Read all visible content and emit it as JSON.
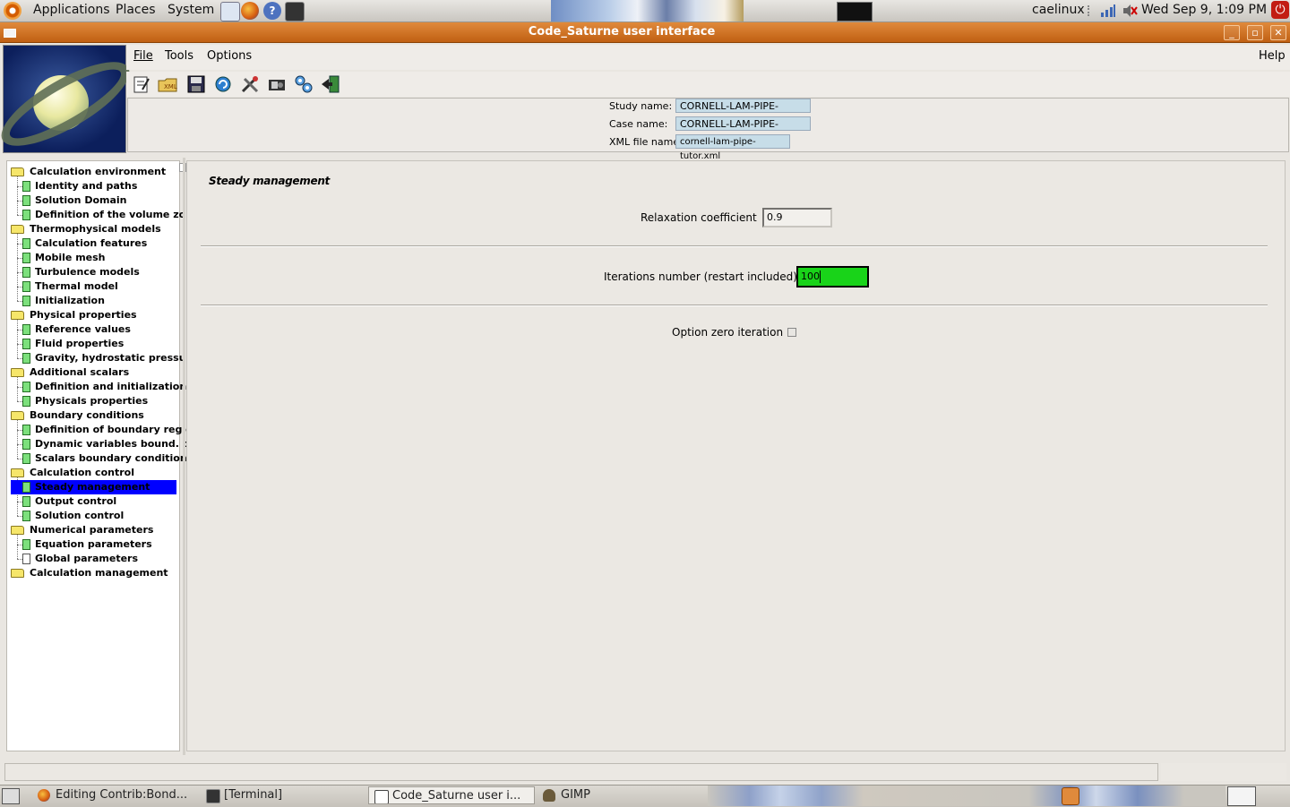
{
  "top_panel": {
    "menus": [
      "Applications",
      "Places",
      "System"
    ],
    "user": "caelinux",
    "clock": "Wed Sep  9,  1:09 PM"
  },
  "window": {
    "title": "Code_Saturne user interface"
  },
  "menubar": {
    "file": "File",
    "tools": "Tools",
    "options": "Options",
    "help": "Help"
  },
  "toolbar": {
    "icons": [
      "new-case-icon",
      "open-xml-icon",
      "save-icon",
      "preprocessor-icon",
      "tools-icon",
      "identity-icon",
      "run-icon",
      "quit-icon"
    ]
  },
  "identity": {
    "study_label": "Study name:",
    "study_value": "CORNELL-LAM-PIPE-TUTOR",
    "case_label": "Case name:",
    "case_value": "CORNELL-LAM-PIPE-TUTOR",
    "xml_label": "XML file name:",
    "xml_value": "cornell-lam-pipe-tutor.xml"
  },
  "tree": {
    "folders": [
      {
        "label": "Calculation environment",
        "items": [
          "Identity and paths",
          "Solution Domain",
          "Definition of the volume zones"
        ]
      },
      {
        "label": "Thermophysical models",
        "items": [
          "Calculation features",
          "Mobile mesh",
          "Turbulence models",
          "Thermal model",
          "Initialization"
        ]
      },
      {
        "label": "Physical properties",
        "items": [
          "Reference values",
          "Fluid properties",
          "Gravity, hydrostatic pressure"
        ]
      },
      {
        "label": "Additional scalars",
        "items": [
          "Definition and initialization",
          "Physicals properties"
        ]
      },
      {
        "label": "Boundary conditions",
        "items": [
          "Definition of boundary regions",
          "Dynamic variables bound. cond.",
          "Scalars boundary conditions"
        ]
      },
      {
        "label": "Calculation control",
        "items": [
          "Steady management",
          "Output control",
          "Solution control"
        ]
      },
      {
        "label": "Numerical parameters",
        "items": [
          "Equation parameters",
          "Global parameters"
        ]
      },
      {
        "label": "Calculation management",
        "items": []
      }
    ],
    "selected": "Steady management"
  },
  "main": {
    "heading": "Steady management",
    "relaxation_label": "Relaxation coefficient",
    "relaxation_value": "0.9",
    "iterations_label": "Iterations number (restart included):",
    "iterations_value": "100",
    "zero_iteration_label": "Option zero iteration",
    "zero_iteration_checked": false
  },
  "taskbar": {
    "tasks": [
      {
        "label": "Editing Contrib:Bond...",
        "icon": "firefox-icon"
      },
      {
        "label": "[Terminal]",
        "icon": "terminal-icon"
      },
      {
        "label": "Code_Saturne user i...",
        "icon": "window-icon",
        "active": true
      },
      {
        "label": "GIMP",
        "icon": "gimp-icon"
      }
    ]
  },
  "colors": {
    "titlebar": "#c96a1c",
    "selection": "#0000ff",
    "active_input": "#19d319",
    "field_bg": "#c7dde8"
  }
}
